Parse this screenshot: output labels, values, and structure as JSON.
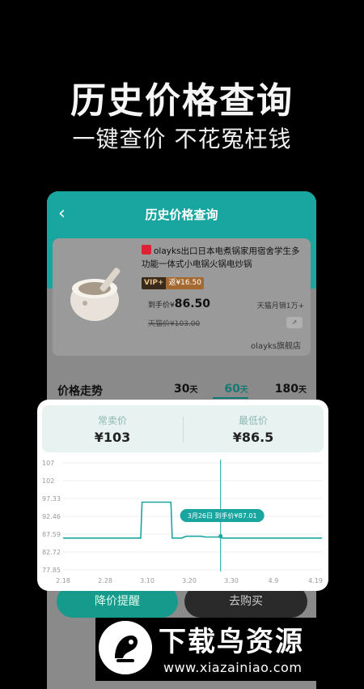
{
  "hero": {
    "title": "历史价格查询",
    "subtitle": "一键查价 不花冤枉钱"
  },
  "nav": {
    "back": "‹",
    "title": "历史价格查询"
  },
  "product": {
    "title": "olayks出口日本电煮锅家用宿舍学生多功能一体式小电锅火锅电炒锅",
    "vip_label": "VIP+",
    "vip_price": "返¥16.50",
    "price_prefix": "到手价¥",
    "price": "86.50",
    "sales": "天猫月销1万+",
    "orig_price": "天猫价¥103.00",
    "store": "olayks旗舰店"
  },
  "trend": {
    "label": "价格走势",
    "periods": [
      {
        "num": "30",
        "unit": "天"
      },
      {
        "num": "60",
        "unit": "天"
      },
      {
        "num": "180",
        "unit": "天"
      }
    ],
    "active": "60"
  },
  "stats": {
    "normal_label": "常卖价",
    "normal_value": "¥103",
    "lowest_label": "最低价",
    "lowest_value": "¥86.5"
  },
  "chart_data": {
    "type": "line",
    "y_ticks": [
      "107",
      "102",
      "97.33",
      "92.46",
      "87.59",
      "82.72",
      "77.85"
    ],
    "ylim": [
      77.85,
      107
    ],
    "x_ticks": [
      "2.18",
      "2.28",
      "3.10",
      "3.20",
      "3.30",
      "4.9",
      "4.19"
    ],
    "series": [
      {
        "values": [
          [
            0,
            86.5
          ],
          [
            18,
            86.5
          ],
          [
            18.3,
            96.3
          ],
          [
            25,
            96.3
          ],
          [
            25.3,
            86.5
          ],
          [
            27.5,
            86.5
          ],
          [
            28.5,
            87.0
          ],
          [
            32,
            87.0
          ],
          [
            33,
            86.8
          ],
          [
            36,
            86.8
          ],
          [
            37,
            86.5
          ],
          [
            60,
            86.5
          ]
        ]
      }
    ],
    "x_range": [
      0,
      60
    ],
    "cursor_x": 36.5,
    "cursor_value": 87.01,
    "tooltip": "3月26日 到手价¥87.01",
    "color": "#1aa6a0"
  },
  "buttons": {
    "remind": "降价提醒",
    "buy": "去购买"
  },
  "watermark": {
    "main": "下载鸟资源",
    "url": "www.xiazainiao.com"
  }
}
